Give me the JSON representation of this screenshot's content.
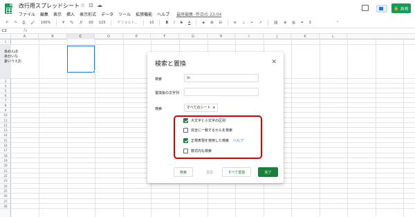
{
  "app": {
    "doc_title": "改行用スプレッドシート",
    "title_icons": [
      "star-icon",
      "move-folder-icon",
      "cloud-status-icon"
    ],
    "menu": [
      "ファイル",
      "編集",
      "表示",
      "挿入",
      "表示形式",
      "データ",
      "ツール",
      "拡張機能",
      "ヘルプ"
    ],
    "last_edit": "最終編集: 昨日の 23:04",
    "share_label": "共有",
    "brand_color": "#0f9d58"
  },
  "toolbar": {
    "zoom": "100%",
    "currency": "¥",
    "percent": "%",
    "decimal_decrease": ".0",
    "decimal_increase": ".00",
    "number_format": "123",
    "font": "デフォルト...",
    "font_size": "10",
    "bold": "B",
    "italic": "I",
    "strike": "S",
    "text_color": "A"
  },
  "formula_bar": {
    "name_box": "C2",
    "fx": "fx"
  },
  "grid": {
    "columns": [
      "A",
      "B",
      "C",
      "D",
      "E",
      "F",
      "G",
      "H",
      "I",
      "J",
      "K",
      "L"
    ],
    "selected_column": "C",
    "rows": [
      "1",
      "2",
      "3",
      "4",
      "5",
      "6",
      "7",
      "8",
      "9",
      "10",
      "11",
      "12",
      "13",
      "14",
      "15",
      "16",
      "17",
      "18",
      "19",
      "20",
      "21",
      "22",
      "23",
      "24",
      "25",
      "26",
      "27",
      "28"
    ],
    "selected_row": "2",
    "a2_value": "あめんぼ\nあかいな\nあいうえお"
  },
  "dialog": {
    "title": "検索と置換",
    "find_label": "検索",
    "find_value": "\\n",
    "replace_label": "置換後の文字列",
    "replace_value": "",
    "scope_label": "検索",
    "scope_value": "すべてのシート",
    "options": [
      {
        "label": "大文字と小文字の区別",
        "checked": true
      },
      {
        "label": "完全に一致するセルを検索",
        "checked": false
      },
      {
        "label": "正規表現を使用した検索",
        "checked": true,
        "link": "ヘルプ"
      },
      {
        "label": "数式内も検索",
        "checked": false
      }
    ],
    "buttons": {
      "find": "検索",
      "replace": "置換",
      "replace_all": "すべて置換",
      "done": "完了"
    },
    "highlight_color": "#d50000",
    "accent_color": "#188038"
  }
}
